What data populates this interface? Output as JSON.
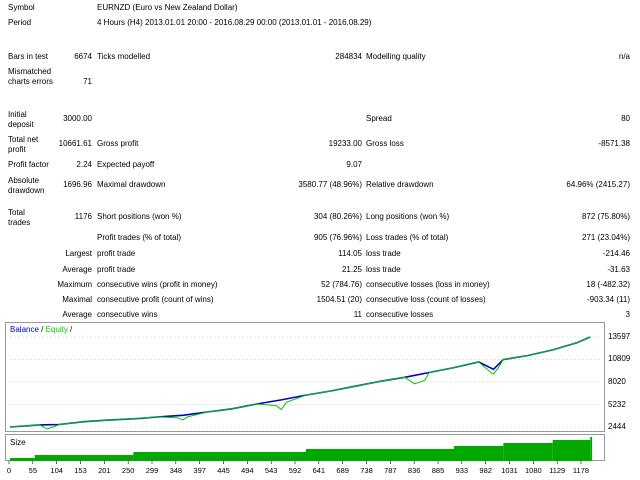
{
  "report": {
    "symbol_label": "Symbol",
    "symbol_value": "EURNZD (Euro vs New Zealand Dollar)",
    "period_label": "Period",
    "period_value": "4 Hours (H4) 2013.01.01 20:00 - 2016.08.29 00:00 (2013.01.01 - 2016.08.29)",
    "bars_label": "Bars in test",
    "bars_value": "6674",
    "ticks_label": "Ticks modelled",
    "ticks_value": "284834",
    "quality_label": "Modelling quality",
    "quality_value": "n/a",
    "mismatch_label": "Mismatched charts errors",
    "mismatch_value": "71",
    "deposit_label": "Initial deposit",
    "deposit_value": "3000.00",
    "spread_label": "Spread",
    "spread_value": "80",
    "netprofit_label": "Total net profit",
    "netprofit_value": "10661.61",
    "grossprofit_label": "Gross profit",
    "grossprofit_value": "19233.00",
    "grossloss_label": "Gross loss",
    "grossloss_value": "-8571.38",
    "pf_label": "Profit factor",
    "pf_value": "2.24",
    "payoff_label": "Expected payoff",
    "payoff_value": "9.07",
    "absdd_label": "Absolute drawdown",
    "absdd_value": "1696.96",
    "maxdd_label": "Maximal drawdown",
    "maxdd_value": "3580.77 (48.96%)",
    "reldd_label": "Relative drawdown",
    "reldd_value": "64.96% (2415.27)",
    "trades_label": "Total trades",
    "trades_value": "1176",
    "short_label": "Short positions (won %)",
    "short_value": "304 (80.26%)",
    "long_label": "Long positions (won %)",
    "long_value": "872 (75.80%)",
    "ptrades_label": "Profit trades (% of total)",
    "ptrades_value": "905 (76.96%)",
    "ltrades_label": "Loss trades (% of total)",
    "ltrades_value": "271 (23.04%)",
    "largest_label": "Largest",
    "lp_label": "profit trade",
    "lp_value": "114.05",
    "ll_label": "loss trade",
    "ll_value": "-214.46",
    "average_label": "Average",
    "ap_label": "profit trade",
    "ap_value": "21.25",
    "al_label": "loss trade",
    "al_value": "-31.63",
    "maximum_label": "Maximum",
    "mcw_label": "consecutive wins (profit in money)",
    "mcw_value": "52 (784.76)",
    "mcl_label": "consecutive losses (loss in money)",
    "mcl_value": "18 (-482.32)",
    "maximal_label": "Maximal",
    "mcp_label": "consecutive profit (count of wins)",
    "mcp_value": "1504.51 (20)",
    "mcloss_label": "consecutive loss (count of losses)",
    "mcloss_value": "-903.34 (11)",
    "average2_label": "Average",
    "acw_label": "consecutive wins",
    "acw_value": "11",
    "acl_label": "consecutive losses",
    "acl_value": "3"
  },
  "legend": {
    "balance": "Balance",
    "sep1": " / ",
    "equity": "Equity",
    "sep2": " /"
  },
  "size_label": "Size",
  "colors": {
    "balance": "#0000c8",
    "equity": "#00c800",
    "size": "#00a800",
    "grid": "#c8c8c8"
  },
  "chart_data": {
    "type": "line",
    "series": [
      {
        "name": "Balance",
        "x": [
          0,
          60,
          100,
          150,
          200,
          260,
          300,
          350,
          400,
          450,
          500,
          550,
          600,
          650,
          700,
          750,
          800,
          850,
          900,
          950,
          980,
          1000,
          1050,
          1100,
          1150,
          1176
        ],
        "values": [
          2444,
          2700,
          2750,
          3100,
          3300,
          3500,
          3700,
          3900,
          4300,
          4700,
          5300,
          5800,
          6400,
          6900,
          7500,
          8100,
          8600,
          9200,
          9800,
          10500,
          9600,
          10800,
          11300,
          12000,
          12900,
          13597
        ]
      },
      {
        "name": "Equity",
        "x": [
          0,
          60,
          75,
          90,
          100,
          150,
          200,
          250,
          300,
          340,
          350,
          360,
          400,
          450,
          500,
          540,
          550,
          560,
          600,
          650,
          700,
          750,
          800,
          820,
          840,
          850,
          900,
          950,
          975,
          980,
          990,
          1000,
          1050,
          1100,
          1150,
          1176
        ],
        "values": [
          2444,
          2700,
          2200,
          2500,
          2750,
          3100,
          3300,
          3500,
          3700,
          3600,
          3300,
          3700,
          4300,
          4700,
          5300,
          5100,
          4600,
          5500,
          6400,
          6900,
          7500,
          8100,
          8600,
          7800,
          8200,
          9200,
          9800,
          10500,
          9200,
          9000,
          9800,
          10800,
          11300,
          12000,
          12900,
          13597
        ]
      }
    ],
    "y_ticks": [
      "13597",
      "10809",
      "8020",
      "5232",
      "2444"
    ],
    "y_range": [
      2444,
      13597
    ],
    "x_ticks": [
      "0",
      "55",
      "104",
      "153",
      "201",
      "250",
      "299",
      "348",
      "397",
      "445",
      "494",
      "543",
      "592",
      "641",
      "689",
      "738",
      "787",
      "836",
      "885",
      "933",
      "982",
      "1031",
      "1080",
      "1129",
      "1178"
    ],
    "x_range": [
      0,
      1200
    ],
    "size_steps": [
      [
        0,
        1
      ],
      [
        50,
        2
      ],
      [
        250,
        3
      ],
      [
        600,
        4
      ],
      [
        900,
        5
      ],
      [
        1000,
        6
      ],
      [
        1100,
        7
      ],
      [
        1176,
        8
      ]
    ],
    "size_max": 8
  }
}
